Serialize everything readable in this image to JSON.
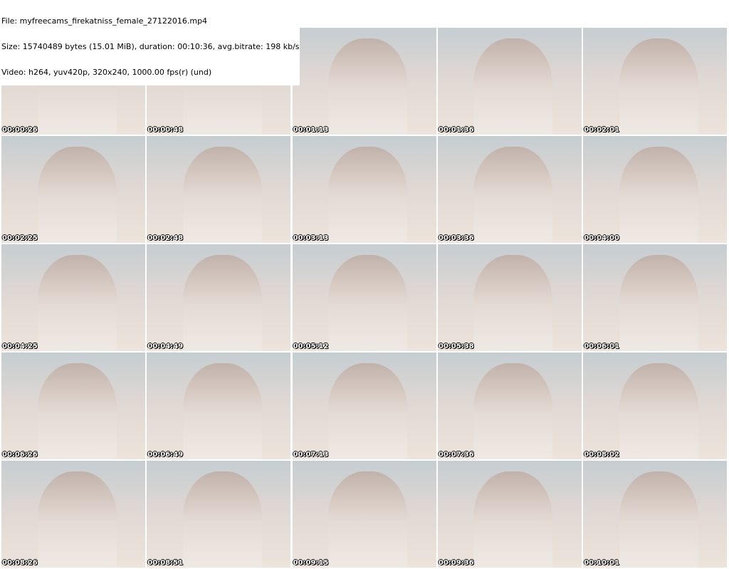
{
  "header": {
    "file": "File: myfreecams_firekatniss_female_27122016.mp4",
    "size": "Size: 15740489 bytes (15.01 MiB), duration: 00:10:36, avg.bitrate: 198 kb/s",
    "video": "Video: h264, yuv420p, 320x240, 1000.00 fps(r) (und)"
  },
  "timestamps": [
    "00:00:26",
    "00:00:48",
    "00:01:13",
    "00:01:36",
    "00:02:01",
    "00:02:25",
    "00:02:48",
    "00:03:13",
    "00:03:36",
    "00:04:00",
    "00:04:25",
    "00:04:49",
    "00:05:12",
    "00:05:38",
    "00:06:01",
    "00:06:26",
    "00:06:49",
    "00:07:13",
    "00:07:36",
    "00:08:02",
    "00:08:26",
    "00:08:51",
    "00:09:15",
    "00:09:36",
    "00:10:01"
  ]
}
